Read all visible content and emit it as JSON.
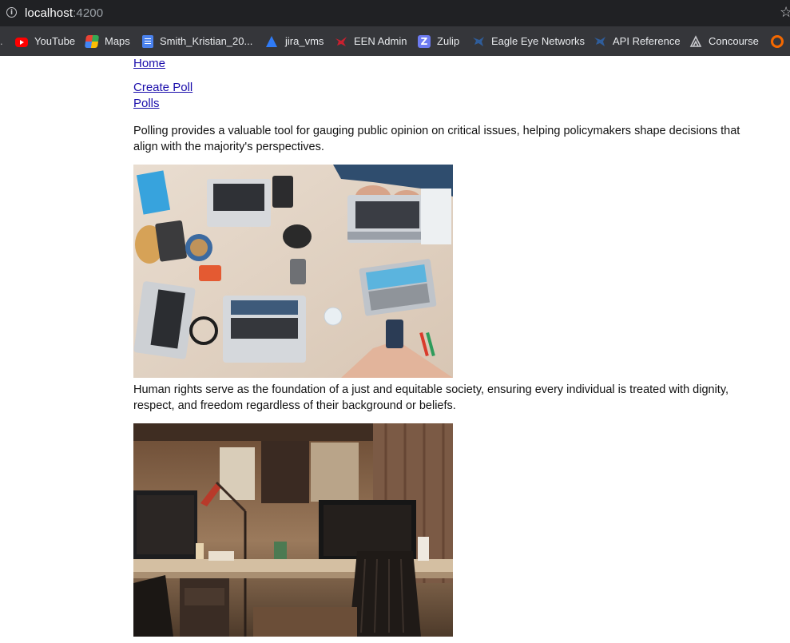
{
  "browser": {
    "url_host": "localhost",
    "url_port": ":4200",
    "bookmarks": [
      {
        "label": "YouTube",
        "icon": "youtube-icon"
      },
      {
        "label": "Maps",
        "icon": "maps-icon"
      },
      {
        "label": "Smith_Kristian_20...",
        "icon": "doc-icon"
      },
      {
        "label": "jira_vms",
        "icon": "jira-icon"
      },
      {
        "label": "EEN Admin",
        "icon": "een-icon"
      },
      {
        "label": "Zulip",
        "icon": "zulip-icon"
      },
      {
        "label": "Eagle Eye Networks",
        "icon": "eagle-eye-icon"
      },
      {
        "label": "API Reference",
        "icon": "api-icon"
      },
      {
        "label": "Concourse",
        "icon": "concourse-icon"
      }
    ]
  },
  "nav": {
    "home": "Home",
    "create_poll": "Create Poll",
    "polls": "Polls"
  },
  "sections": [
    {
      "text": "Polling provides a valuable tool for gauging public opinion on critical issues, helping policymakers shape decisions that align with the majority's perspectives."
    },
    {
      "text": "Human rights serve as the foundation of a just and equitable society, ensuring every individual is treated with dignity, respect, and freedom regardless of their background or beliefs."
    }
  ]
}
